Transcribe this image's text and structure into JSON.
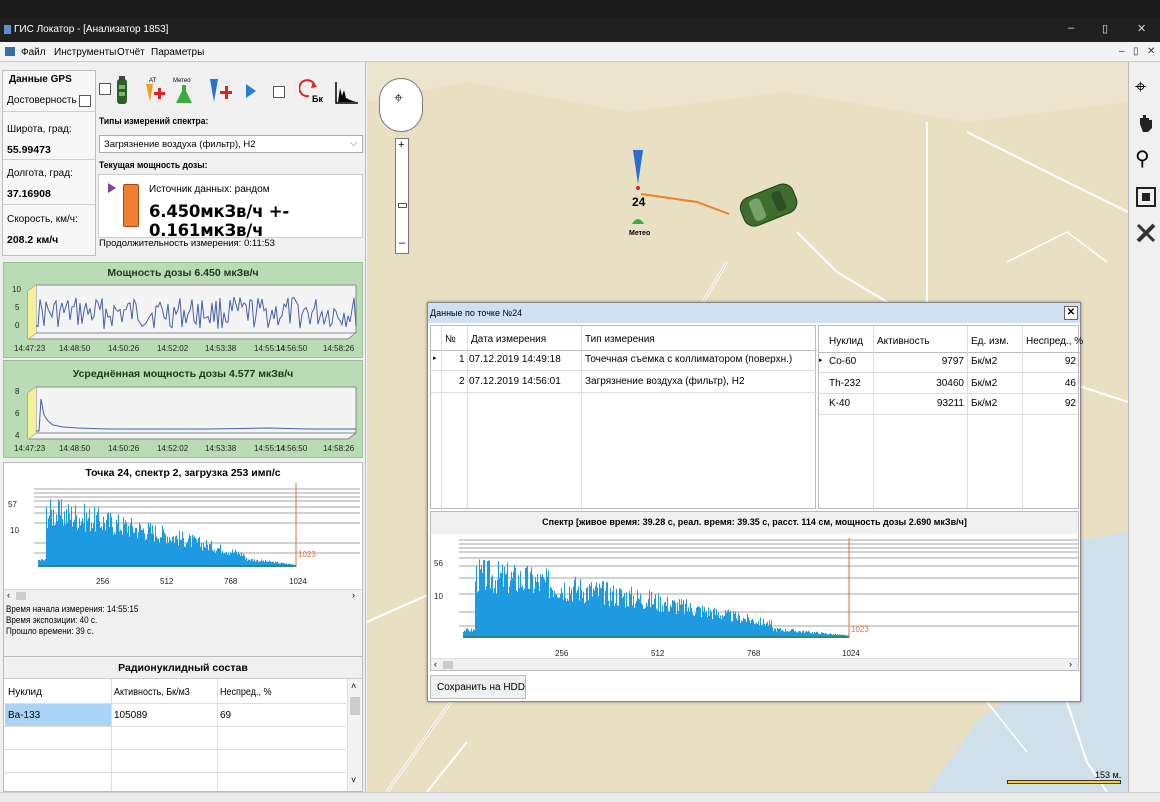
{
  "window": {
    "title": "ГИС Локатор - [Анализатор 1853]",
    "controls": [
      "–",
      "▯",
      "✕"
    ]
  },
  "menu": {
    "items": [
      "Файл",
      "Инструменты",
      "Отчёт",
      "Параметры"
    ],
    "mdi_controls": [
      "–",
      "▯",
      "✕"
    ]
  },
  "gps": {
    "title": "Данные GPS",
    "reliability_label": "Достоверность",
    "lat_label": "Широта, град:",
    "lat_value": "55.99473",
    "lon_label": "Долгота, град:",
    "lon_value": "37.16908",
    "speed_label": "Скорость, км/ч:",
    "speed_value": "208.2 км/ч"
  },
  "toolbar": {
    "at_label": "AT",
    "meteo_label": "Метео",
    "bk_label": "Бк"
  },
  "spectrum_types": {
    "label": "Типы измерений спектра:",
    "selected": "Загрязнение воздуха (фильтр), Н2"
  },
  "dose": {
    "label": "Текущая мощность дозы:",
    "source": "Источник данных: рандом",
    "value": "6.450мкЗв/ч +- 0.161мкЗв/ч",
    "duration": "Продолжительность измерения: 0:11:53",
    "indicator_color": "#f08030"
  },
  "dose_chart": {
    "title": "Мощность дозы 6.450 мкЗв/ч",
    "y_ticks": [
      "10",
      "5",
      "0"
    ],
    "x_ticks": [
      "14:47:23",
      "14:48:50",
      "14:50:26",
      "14:52:02",
      "14:53:38",
      "14:55:14",
      "14:56:50",
      "14:58:26"
    ]
  },
  "avg_chart": {
    "title": "Усреднённая мощность дозы 4.577 мкЗв/ч",
    "y_ticks": [
      "8",
      "6",
      "4"
    ],
    "x_ticks": [
      "14:47:23",
      "14:48:50",
      "14:50:26",
      "14:52:02",
      "14:53:38",
      "14:55:14",
      "14:56:50",
      "14:58:26"
    ]
  },
  "spectrum_left": {
    "title": "Точка 24, спектр 2, загрузка 253 имп/с",
    "y_ticks": [
      "57",
      "10"
    ],
    "x_ticks": [
      "256",
      "512",
      "768",
      "1024"
    ],
    "marker": "1023",
    "start_time": "Время начала измерения: 14:55:15",
    "exposure": "Время экспозиции: 40 с.",
    "elapsed": "Прошло времени: 39 с."
  },
  "nuclides": {
    "title": "Радионуклидный состав",
    "headers": [
      "Нуклид",
      "Активность, Бк/м3",
      "Неспред., %"
    ],
    "rows": [
      [
        "Ba-133",
        "105089",
        "69"
      ]
    ]
  },
  "map": {
    "point_number": "24",
    "meteo_label": "Метео",
    "scale_label": "153 м."
  },
  "dialog": {
    "title": "Данные по точке №24",
    "close": "✕",
    "meas_headers": [
      "№",
      "Дата измерения",
      "Тип измерения"
    ],
    "meas_rows": [
      [
        "1",
        "07.12.2019 14:49:18",
        "Точечная съемка с коллиматором (поверхн.)"
      ],
      [
        "2",
        "07.12.2019 14:56:01",
        "Загрязнение воздуха (фильтр), Н2"
      ]
    ],
    "nuc_headers": [
      "Нуклид",
      "Активность",
      "Ед. изм.",
      "Неспред., %"
    ],
    "nuc_rows": [
      [
        "Co-60",
        "9797",
        "Бк/м2",
        "92"
      ],
      [
        "Th-232",
        "30460",
        "Бк/м2",
        "46"
      ],
      [
        "K-40",
        "93211",
        "Бк/м2",
        "92"
      ]
    ],
    "spectrum_title": "Спектр  [живое время: 39.28 с, реал. время: 39.35 с, расст. 114 см, мощность дозы 2.690 мкЗв/ч]",
    "y_ticks": [
      "56",
      "10"
    ],
    "x_ticks": [
      "256",
      "512",
      "768",
      "1024"
    ],
    "marker": "1023",
    "save_button": "Сохранить на HDD"
  }
}
